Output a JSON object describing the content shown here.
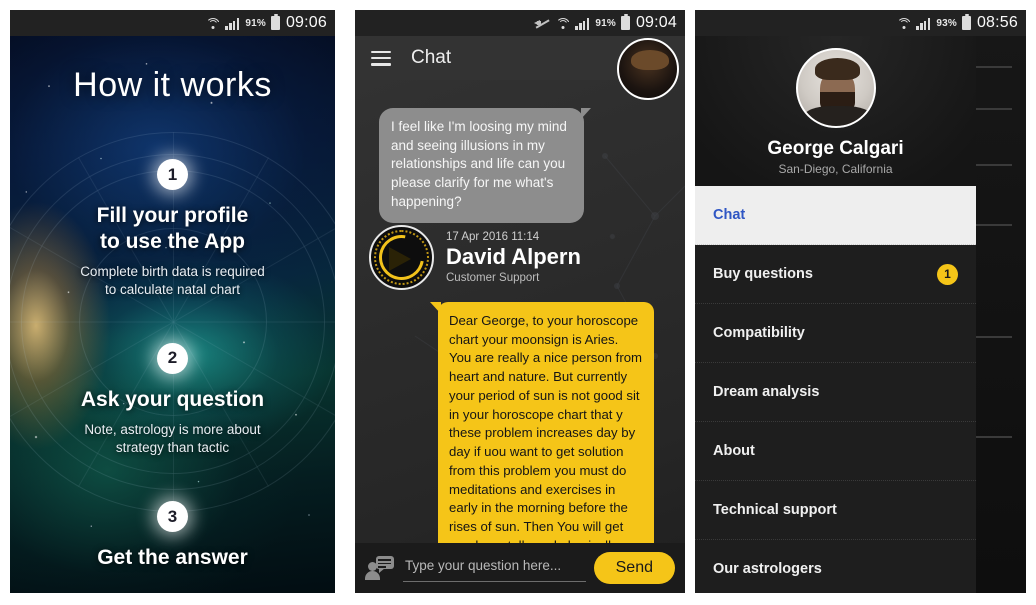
{
  "panels": {
    "onboarding": {
      "status": {
        "wifi": "wifi-icon",
        "signal": "signal-icon",
        "battery_pct": "91%",
        "time": "09:06"
      },
      "title": "How it works",
      "steps": [
        {
          "num": "1",
          "head": "Fill your profile\nto use the App",
          "sub": "Complete birth data is required\nto calculate natal chart"
        },
        {
          "num": "2",
          "head": "Ask your question",
          "sub": "Note, astrology is more about\nstrategy than tactic"
        },
        {
          "num": "3",
          "head": "Get the answer",
          "sub": ""
        }
      ]
    },
    "chat": {
      "status": {
        "mute": "mute-icon",
        "wifi": "wifi-icon",
        "signal": "signal-icon",
        "battery_pct": "91%",
        "time": "09:04"
      },
      "appbar": {
        "menu_icon": "hamburger-icon",
        "title": "Chat"
      },
      "messages": [
        {
          "side": "right",
          "text": "I feel like I'm loosing my mind and seeing illusions in my relationships and life can you please clarify for me what's happening?"
        },
        {
          "side": "left",
          "timestamp": "17 Apr 2016 11:14",
          "name": "David Alpern",
          "role": "Customer Support",
          "text": "Dear George, to your horoscope chart your moonsign is Aries. You are really a nice person from heart and nature. But currently your period of sun is not good sit in your horoscope chart that y these problem increases day by day if uou want to get solution from this problem you must do meditations and exercises in early in the morning before the rises of sun. Then You will get good mentally and physically health. Take care."
        }
      ],
      "input": {
        "icon": "user-message-icon",
        "placeholder": "Type your question here...",
        "value": "",
        "send_label": "Send"
      }
    },
    "drawer": {
      "status": {
        "wifi": "wifi-icon",
        "signal": "signal-icon",
        "battery_pct": "93%",
        "time": "08:56"
      },
      "profile": {
        "avatar": "user-avatar",
        "name": "George Calgari",
        "location": "San-Diego, California"
      },
      "items": [
        {
          "label": "Chat",
          "active": true,
          "badge": ""
        },
        {
          "label": "Buy questions",
          "active": false,
          "badge": "1"
        },
        {
          "label": "Compatibility",
          "active": false,
          "badge": ""
        },
        {
          "label": "Dream analysis",
          "active": false,
          "badge": ""
        },
        {
          "label": "About",
          "active": false,
          "badge": ""
        },
        {
          "label": "Technical support",
          "active": false,
          "badge": ""
        },
        {
          "label": "Our astrologers",
          "active": false,
          "badge": ""
        }
      ]
    }
  },
  "colors": {
    "accent_yellow": "#f5c518",
    "active_item_text": "#2f56c4",
    "status_bar": "#222222",
    "drawer_bg": "#1e1e1e"
  }
}
